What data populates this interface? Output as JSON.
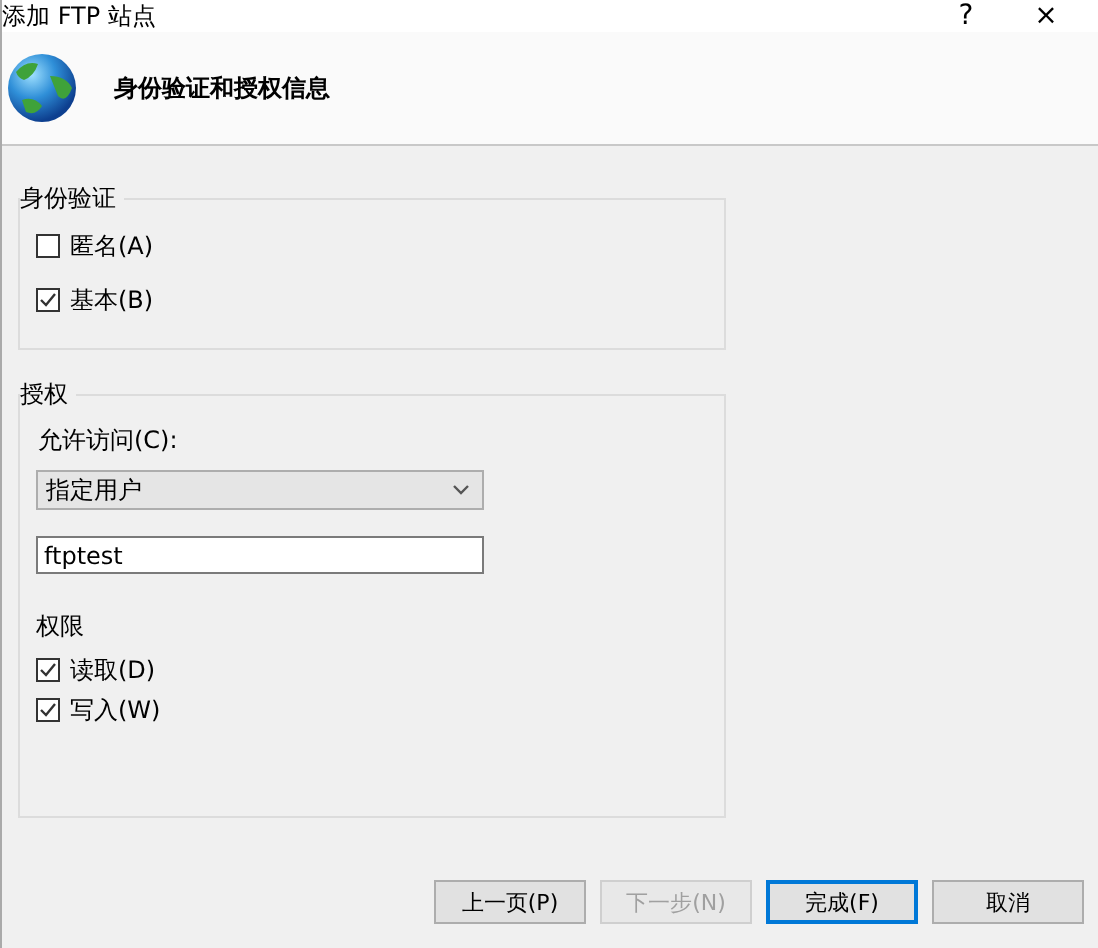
{
  "window": {
    "title": "添加 FTP 站点",
    "help": "?",
    "close": "×"
  },
  "header": {
    "title": "身份验证和授权信息"
  },
  "authentication": {
    "title": "身份验证",
    "options": [
      {
        "label": "匿名(A)",
        "checked": false
      },
      {
        "label": "基本(B)",
        "checked": true
      }
    ]
  },
  "authorization": {
    "title": "授权",
    "access_label": "允许访问(C):",
    "access_value": "指定用户",
    "user": "ftptest",
    "permissions_title": "权限",
    "permissions": [
      {
        "label": "读取(D)",
        "checked": true
      },
      {
        "label": "写入(W)",
        "checked": true
      }
    ]
  },
  "buttons": [
    {
      "label": "上一页(P)",
      "disabled": false,
      "default": false
    },
    {
      "label": "下一步(N)",
      "disabled": true,
      "default": false
    },
    {
      "label": "完成(F)",
      "disabled": false,
      "default": true
    },
    {
      "label": "取消",
      "disabled": false,
      "default": false
    }
  ]
}
